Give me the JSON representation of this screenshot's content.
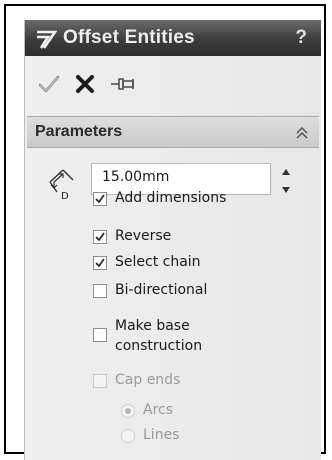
{
  "panel": {
    "title": "Offset Entities",
    "help": "?"
  },
  "actions": {
    "ok_icon": "checkmark-icon",
    "cancel_icon": "x-icon",
    "pin_icon": "pushpin-icon"
  },
  "parameters": {
    "header": "Parameters",
    "distance_value": "15.00mm",
    "distance_icon": "offset-distance-icon",
    "distance_icon_label": "D"
  },
  "options": [
    {
      "label": "Add dimensions",
      "checked": true,
      "enabled": true
    },
    {
      "label": "Reverse",
      "checked": true,
      "enabled": true
    },
    {
      "label": "Select chain",
      "checked": true,
      "enabled": true
    },
    {
      "label": "Bi-directional",
      "checked": false,
      "enabled": true
    },
    {
      "label_lines": [
        "Make base",
        "construction"
      ],
      "checked": false,
      "enabled": true
    },
    {
      "label": "Cap ends",
      "checked": false,
      "enabled": false
    }
  ],
  "cap_end_types": [
    {
      "label": "Arcs",
      "selected": true,
      "enabled": false
    },
    {
      "label": "Lines",
      "selected": false,
      "enabled": false
    }
  ]
}
